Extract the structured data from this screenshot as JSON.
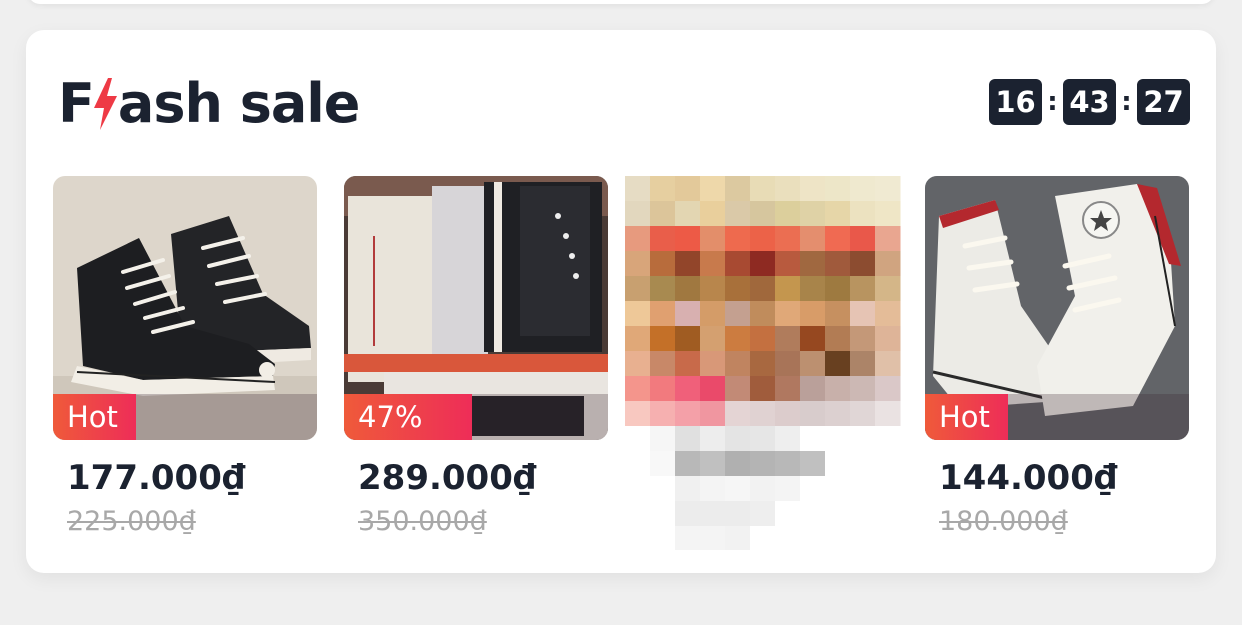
{
  "flash_sale": {
    "title_prefix": "F",
    "title_suffix": "ash sale",
    "countdown": {
      "hours": "16",
      "minutes": "43",
      "seconds": "27",
      "separator": ":"
    },
    "products": [
      {
        "badge": "Hot",
        "price": "177.000₫",
        "old_price": "225.000₫"
      },
      {
        "badge": "47%",
        "price": "289.000₫",
        "old_price": "350.000₫"
      },
      {
        "badge": "",
        "price": "",
        "old_price": ""
      },
      {
        "badge": "Hot",
        "price": "144.000₫",
        "old_price": "180.000₫"
      }
    ]
  },
  "colors": {
    "accent_red": "#ee3a45",
    "text_dark": "#1b2230",
    "old_price_gray": "#a8a8a8"
  },
  "icons": {
    "title_bolt": "lightning-bolt-icon"
  }
}
